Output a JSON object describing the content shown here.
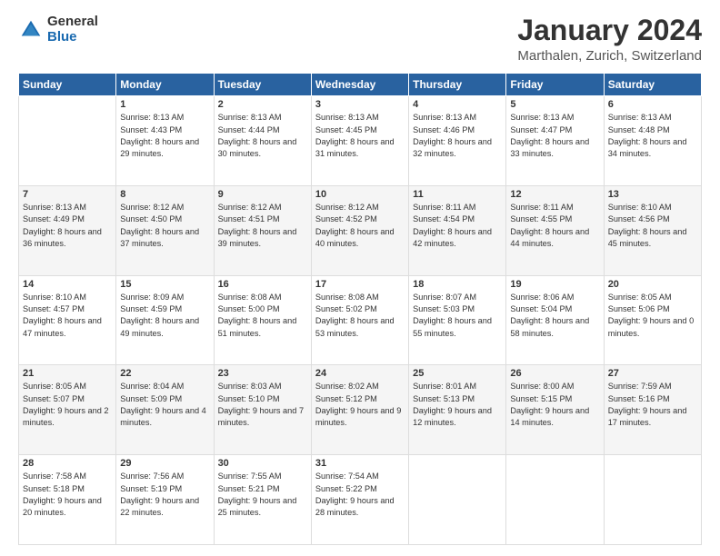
{
  "logo": {
    "general": "General",
    "blue": "Blue"
  },
  "header": {
    "month": "January 2024",
    "location": "Marthalen, Zurich, Switzerland"
  },
  "weekdays": [
    "Sunday",
    "Monday",
    "Tuesday",
    "Wednesday",
    "Thursday",
    "Friday",
    "Saturday"
  ],
  "weeks": [
    [
      {
        "day": "",
        "sunrise": "",
        "sunset": "",
        "daylight": ""
      },
      {
        "day": "1",
        "sunrise": "Sunrise: 8:13 AM",
        "sunset": "Sunset: 4:43 PM",
        "daylight": "Daylight: 8 hours and 29 minutes."
      },
      {
        "day": "2",
        "sunrise": "Sunrise: 8:13 AM",
        "sunset": "Sunset: 4:44 PM",
        "daylight": "Daylight: 8 hours and 30 minutes."
      },
      {
        "day": "3",
        "sunrise": "Sunrise: 8:13 AM",
        "sunset": "Sunset: 4:45 PM",
        "daylight": "Daylight: 8 hours and 31 minutes."
      },
      {
        "day": "4",
        "sunrise": "Sunrise: 8:13 AM",
        "sunset": "Sunset: 4:46 PM",
        "daylight": "Daylight: 8 hours and 32 minutes."
      },
      {
        "day": "5",
        "sunrise": "Sunrise: 8:13 AM",
        "sunset": "Sunset: 4:47 PM",
        "daylight": "Daylight: 8 hours and 33 minutes."
      },
      {
        "day": "6",
        "sunrise": "Sunrise: 8:13 AM",
        "sunset": "Sunset: 4:48 PM",
        "daylight": "Daylight: 8 hours and 34 minutes."
      }
    ],
    [
      {
        "day": "7",
        "sunrise": "Sunrise: 8:13 AM",
        "sunset": "Sunset: 4:49 PM",
        "daylight": "Daylight: 8 hours and 36 minutes."
      },
      {
        "day": "8",
        "sunrise": "Sunrise: 8:12 AM",
        "sunset": "Sunset: 4:50 PM",
        "daylight": "Daylight: 8 hours and 37 minutes."
      },
      {
        "day": "9",
        "sunrise": "Sunrise: 8:12 AM",
        "sunset": "Sunset: 4:51 PM",
        "daylight": "Daylight: 8 hours and 39 minutes."
      },
      {
        "day": "10",
        "sunrise": "Sunrise: 8:12 AM",
        "sunset": "Sunset: 4:52 PM",
        "daylight": "Daylight: 8 hours and 40 minutes."
      },
      {
        "day": "11",
        "sunrise": "Sunrise: 8:11 AM",
        "sunset": "Sunset: 4:54 PM",
        "daylight": "Daylight: 8 hours and 42 minutes."
      },
      {
        "day": "12",
        "sunrise": "Sunrise: 8:11 AM",
        "sunset": "Sunset: 4:55 PM",
        "daylight": "Daylight: 8 hours and 44 minutes."
      },
      {
        "day": "13",
        "sunrise": "Sunrise: 8:10 AM",
        "sunset": "Sunset: 4:56 PM",
        "daylight": "Daylight: 8 hours and 45 minutes."
      }
    ],
    [
      {
        "day": "14",
        "sunrise": "Sunrise: 8:10 AM",
        "sunset": "Sunset: 4:57 PM",
        "daylight": "Daylight: 8 hours and 47 minutes."
      },
      {
        "day": "15",
        "sunrise": "Sunrise: 8:09 AM",
        "sunset": "Sunset: 4:59 PM",
        "daylight": "Daylight: 8 hours and 49 minutes."
      },
      {
        "day": "16",
        "sunrise": "Sunrise: 8:08 AM",
        "sunset": "Sunset: 5:00 PM",
        "daylight": "Daylight: 8 hours and 51 minutes."
      },
      {
        "day": "17",
        "sunrise": "Sunrise: 8:08 AM",
        "sunset": "Sunset: 5:02 PM",
        "daylight": "Daylight: 8 hours and 53 minutes."
      },
      {
        "day": "18",
        "sunrise": "Sunrise: 8:07 AM",
        "sunset": "Sunset: 5:03 PM",
        "daylight": "Daylight: 8 hours and 55 minutes."
      },
      {
        "day": "19",
        "sunrise": "Sunrise: 8:06 AM",
        "sunset": "Sunset: 5:04 PM",
        "daylight": "Daylight: 8 hours and 58 minutes."
      },
      {
        "day": "20",
        "sunrise": "Sunrise: 8:05 AM",
        "sunset": "Sunset: 5:06 PM",
        "daylight": "Daylight: 9 hours and 0 minutes."
      }
    ],
    [
      {
        "day": "21",
        "sunrise": "Sunrise: 8:05 AM",
        "sunset": "Sunset: 5:07 PM",
        "daylight": "Daylight: 9 hours and 2 minutes."
      },
      {
        "day": "22",
        "sunrise": "Sunrise: 8:04 AM",
        "sunset": "Sunset: 5:09 PM",
        "daylight": "Daylight: 9 hours and 4 minutes."
      },
      {
        "day": "23",
        "sunrise": "Sunrise: 8:03 AM",
        "sunset": "Sunset: 5:10 PM",
        "daylight": "Daylight: 9 hours and 7 minutes."
      },
      {
        "day": "24",
        "sunrise": "Sunrise: 8:02 AM",
        "sunset": "Sunset: 5:12 PM",
        "daylight": "Daylight: 9 hours and 9 minutes."
      },
      {
        "day": "25",
        "sunrise": "Sunrise: 8:01 AM",
        "sunset": "Sunset: 5:13 PM",
        "daylight": "Daylight: 9 hours and 12 minutes."
      },
      {
        "day": "26",
        "sunrise": "Sunrise: 8:00 AM",
        "sunset": "Sunset: 5:15 PM",
        "daylight": "Daylight: 9 hours and 14 minutes."
      },
      {
        "day": "27",
        "sunrise": "Sunrise: 7:59 AM",
        "sunset": "Sunset: 5:16 PM",
        "daylight": "Daylight: 9 hours and 17 minutes."
      }
    ],
    [
      {
        "day": "28",
        "sunrise": "Sunrise: 7:58 AM",
        "sunset": "Sunset: 5:18 PM",
        "daylight": "Daylight: 9 hours and 20 minutes."
      },
      {
        "day": "29",
        "sunrise": "Sunrise: 7:56 AM",
        "sunset": "Sunset: 5:19 PM",
        "daylight": "Daylight: 9 hours and 22 minutes."
      },
      {
        "day": "30",
        "sunrise": "Sunrise: 7:55 AM",
        "sunset": "Sunset: 5:21 PM",
        "daylight": "Daylight: 9 hours and 25 minutes."
      },
      {
        "day": "31",
        "sunrise": "Sunrise: 7:54 AM",
        "sunset": "Sunset: 5:22 PM",
        "daylight": "Daylight: 9 hours and 28 minutes."
      },
      {
        "day": "",
        "sunrise": "",
        "sunset": "",
        "daylight": ""
      },
      {
        "day": "",
        "sunrise": "",
        "sunset": "",
        "daylight": ""
      },
      {
        "day": "",
        "sunrise": "",
        "sunset": "",
        "daylight": ""
      }
    ]
  ]
}
